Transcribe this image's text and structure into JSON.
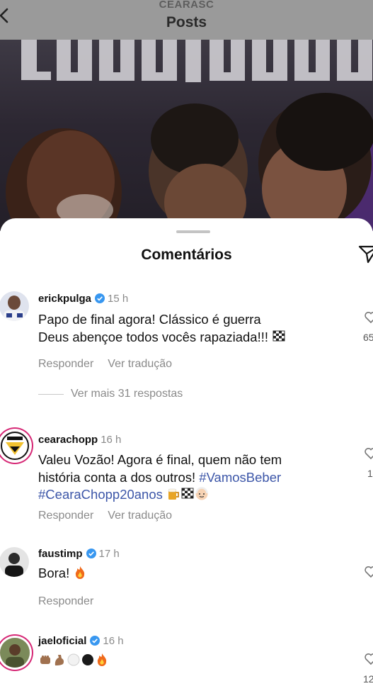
{
  "header": {
    "account": "CEARASC",
    "title": "Posts"
  },
  "sheet": {
    "title": "Comentários"
  },
  "comments": [
    {
      "username": "erickpulga",
      "verified": true,
      "time": "15 h",
      "text_line1": "Papo de final agora! Clássico é guerra",
      "text_line2": "Deus abençoe todos vocês rapaziada!!!",
      "reply": "Responder",
      "translate": "Ver tradução",
      "more_replies": "Ver mais 31 respostas",
      "likes": "65"
    },
    {
      "username": "cearachopp",
      "verified": false,
      "time": "16 h",
      "text_line1": "Valeu Vozão! Agora é final, quem não tem",
      "text_line2": "história conta a dos outros!",
      "hashtag1": "#VamosBeber",
      "hashtag2": "#CearaChopp20anos",
      "reply": "Responder",
      "translate": "Ver tradução",
      "likes": "1"
    },
    {
      "username": "faustimp",
      "verified": true,
      "time": "17 h",
      "text_line1": "Bora!",
      "reply": "Responder"
    },
    {
      "username": "jaeloficial",
      "verified": true,
      "time": "16 h",
      "likes": "12"
    }
  ],
  "icons": {
    "back": "chevron-left-icon",
    "send": "paper-plane-icon",
    "heart": "heart-outline-icon",
    "verified": "verified-badge-icon"
  },
  "colors": {
    "verified": "#3897f0",
    "hashtag": "#3c56a8",
    "story_ring": "#d62976"
  }
}
